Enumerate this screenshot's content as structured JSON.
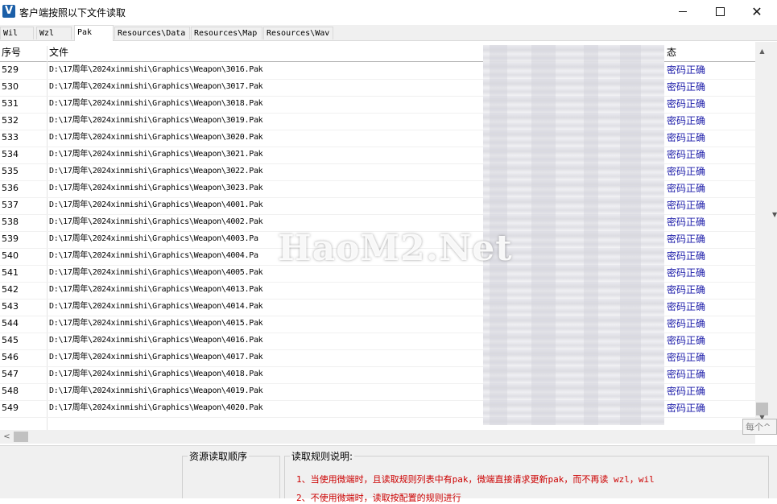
{
  "window": {
    "title": "客户端按照以下文件读取",
    "app_icon_letter": "V",
    "minimize_label": "",
    "maximize_label": "",
    "close_label": "✕"
  },
  "tabs": [
    {
      "label": "Wil"
    },
    {
      "label": "Wzl"
    },
    {
      "label": "Pak",
      "active": true
    },
    {
      "label": "Resources\\Data"
    },
    {
      "label": "Resources\\Map"
    },
    {
      "label": "Resources\\Wav"
    }
  ],
  "list": {
    "columns": {
      "num": "序号",
      "file": "文件",
      "status": "态"
    },
    "rows": [
      {
        "num": "529",
        "path": "D:\\17周年\\2024xinmishi\\Graphics\\Weapon\\3016.Pak",
        "status": "密码正确"
      },
      {
        "num": "530",
        "path": "D:\\17周年\\2024xinmishi\\Graphics\\Weapon\\3017.Pak",
        "status": "密码正确"
      },
      {
        "num": "531",
        "path": "D:\\17周年\\2024xinmishi\\Graphics\\Weapon\\3018.Pak",
        "status": "密码正确"
      },
      {
        "num": "532",
        "path": "D:\\17周年\\2024xinmishi\\Graphics\\Weapon\\3019.Pak",
        "status": "密码正确"
      },
      {
        "num": "533",
        "path": "D:\\17周年\\2024xinmishi\\Graphics\\Weapon\\3020.Pak",
        "status": "密码正确"
      },
      {
        "num": "534",
        "path": "D:\\17周年\\2024xinmishi\\Graphics\\Weapon\\3021.Pak",
        "status": "密码正确"
      },
      {
        "num": "535",
        "path": "D:\\17周年\\2024xinmishi\\Graphics\\Weapon\\3022.Pak",
        "status": "密码正确"
      },
      {
        "num": "536",
        "path": "D:\\17周年\\2024xinmishi\\Graphics\\Weapon\\3023.Pak",
        "status": "密码正确"
      },
      {
        "num": "537",
        "path": "D:\\17周年\\2024xinmishi\\Graphics\\Weapon\\4001.Pak",
        "status": "密码正确"
      },
      {
        "num": "538",
        "path": "D:\\17周年\\2024xinmishi\\Graphics\\Weapon\\4002.Pak",
        "status": "密码正确"
      },
      {
        "num": "539",
        "path": "D:\\17周年\\2024xinmishi\\Graphics\\Weapon\\4003.Pa",
        "status": "密码正确"
      },
      {
        "num": "540",
        "path": "D:\\17周年\\2024xinmishi\\Graphics\\Weapon\\4004.Pa",
        "status": "密码正确"
      },
      {
        "num": "541",
        "path": "D:\\17周年\\2024xinmishi\\Graphics\\Weapon\\4005.Pak",
        "status": "密码正确"
      },
      {
        "num": "542",
        "path": "D:\\17周年\\2024xinmishi\\Graphics\\Weapon\\4013.Pak",
        "status": "密码正确"
      },
      {
        "num": "543",
        "path": "D:\\17周年\\2024xinmishi\\Graphics\\Weapon\\4014.Pak",
        "status": "密码正确"
      },
      {
        "num": "544",
        "path": "D:\\17周年\\2024xinmishi\\Graphics\\Weapon\\4015.Pak",
        "status": "密码正确"
      },
      {
        "num": "545",
        "path": "D:\\17周年\\2024xinmishi\\Graphics\\Weapon\\4016.Pak",
        "status": "密码正确"
      },
      {
        "num": "546",
        "path": "D:\\17周年\\2024xinmishi\\Graphics\\Weapon\\4017.Pak",
        "status": "密码正确"
      },
      {
        "num": "547",
        "path": "D:\\17周年\\2024xinmishi\\Graphics\\Weapon\\4018.Pak",
        "status": "密码正确"
      },
      {
        "num": "548",
        "path": "D:\\17周年\\2024xinmishi\\Graphics\\Weapon\\4019.Pak",
        "status": "密码正确"
      },
      {
        "num": "549",
        "path": "D:\\17周年\\2024xinmishi\\Graphics\\Weapon\\4020.Pak",
        "status": "密码正确"
      }
    ],
    "status_color": "#1a1aa8"
  },
  "watermark": "HaoM2.Net",
  "side_tip": "每个^",
  "bottom": {
    "order_title": "资源读取顺序",
    "rules_title": "读取规则说明:",
    "rule1": "1、当使用微端时，且读取规则列表中有pak，微端直接请求更新pak，而不再读 wzl，wil",
    "rule2": "2、不使用微端时，读取按配置的规则进行",
    "rule_color": "#cc0000"
  }
}
